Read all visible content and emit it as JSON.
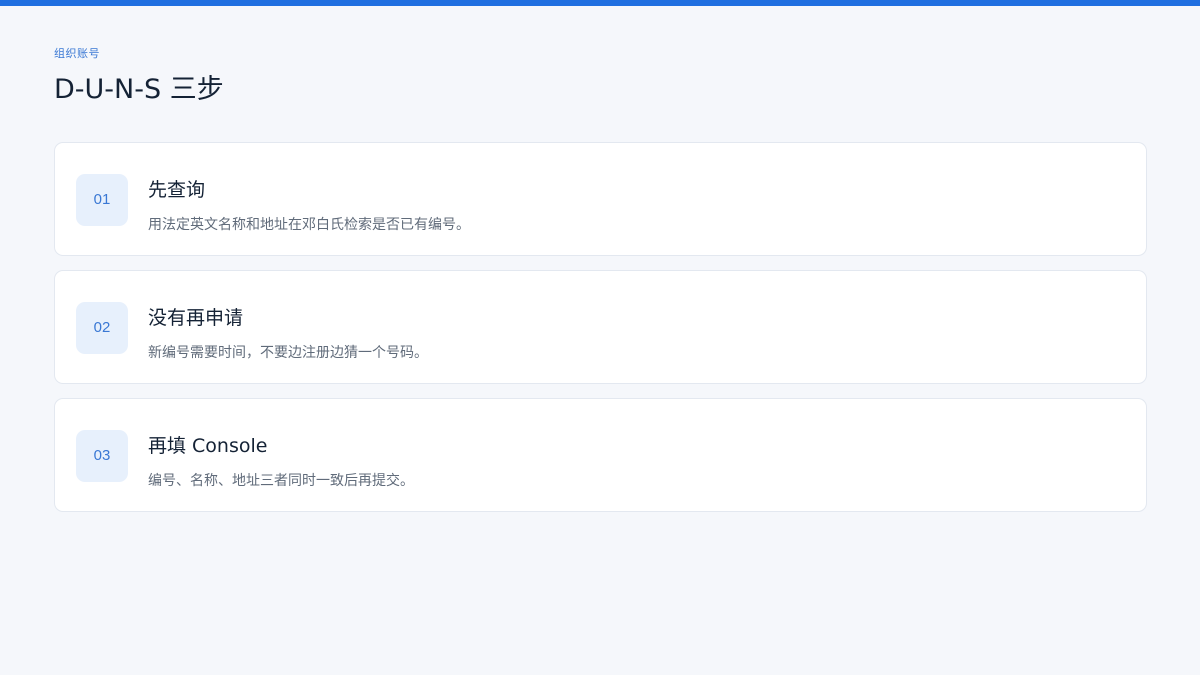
{
  "header": {
    "eyebrow": "组织账号",
    "title": "D-U-N-S 三步"
  },
  "colors": {
    "accent": "#1f6fe0",
    "badge_bg": "#e7f0fc",
    "badge_text": "#3a78d4",
    "background": "#f5f7fb"
  },
  "steps": [
    {
      "number": "01",
      "title": "先查询",
      "description": "用法定英文名称和地址在邓白氏检索是否已有编号。"
    },
    {
      "number": "02",
      "title": "没有再申请",
      "description": "新编号需要时间，不要边注册边猜一个号码。"
    },
    {
      "number": "03",
      "title": "再填 Console",
      "description": "编号、名称、地址三者同时一致后再提交。"
    }
  ]
}
